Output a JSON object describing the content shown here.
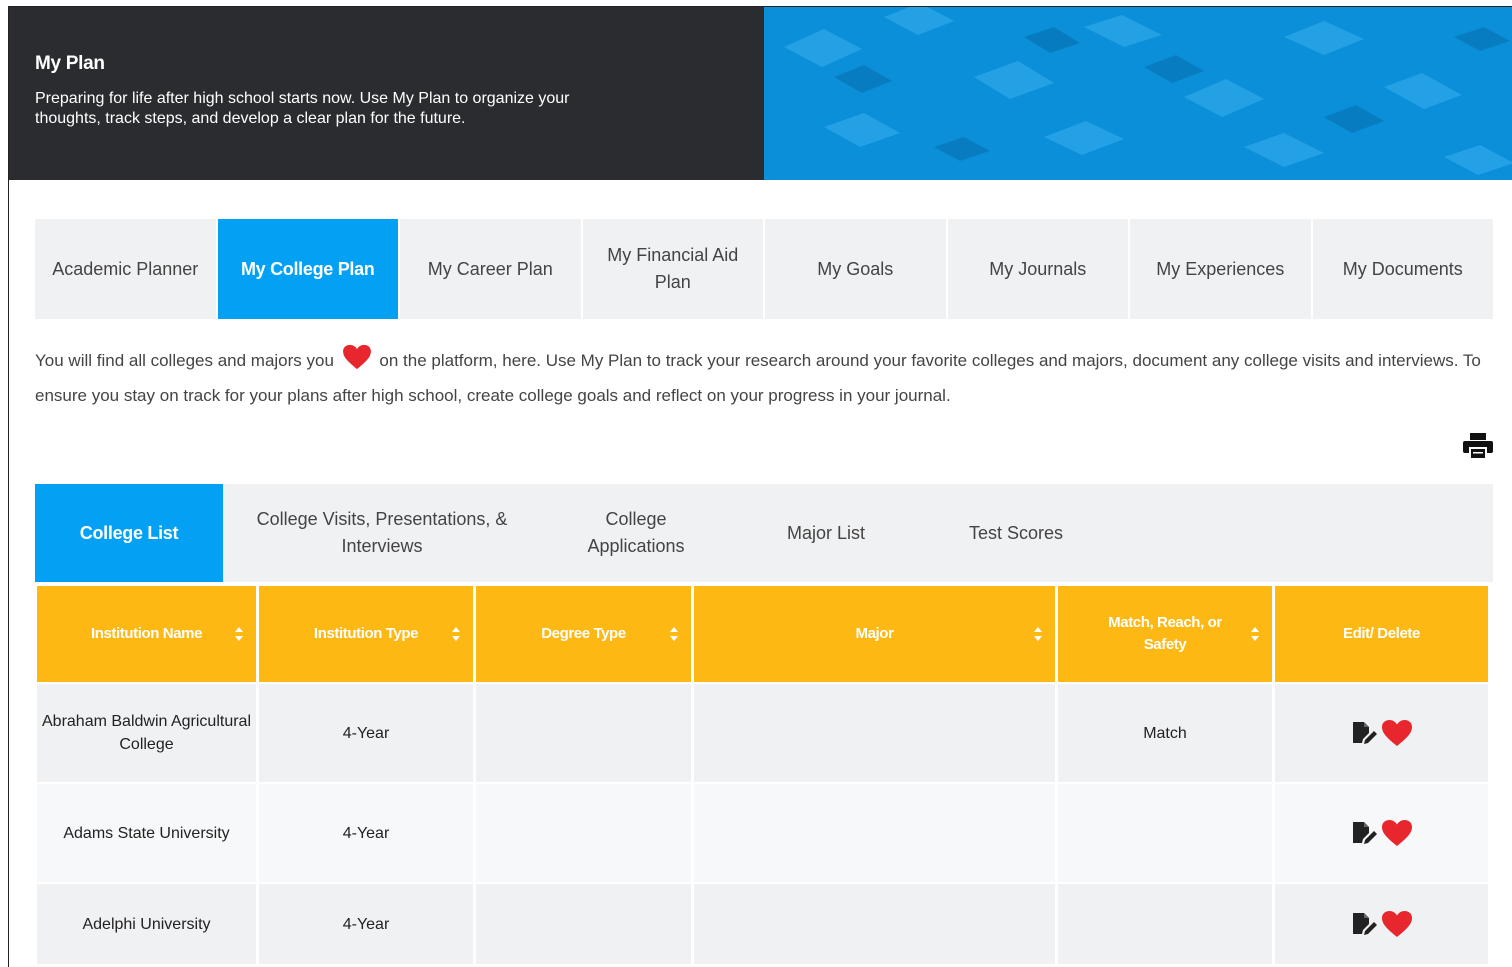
{
  "banner": {
    "title": "My Plan",
    "description": "Preparing for life after high school starts now. Use My Plan to organize your thoughts, track steps, and develop a clear plan for the future."
  },
  "main_tabs": [
    {
      "label": "Academic Planner",
      "active": false
    },
    {
      "label": "My College Plan",
      "active": true
    },
    {
      "label": "My Career Plan",
      "active": false
    },
    {
      "label": "My Financial Aid Plan",
      "active": false
    },
    {
      "label": "My Goals",
      "active": false
    },
    {
      "label": "My Journals",
      "active": false
    },
    {
      "label": "My Experiences",
      "active": false
    },
    {
      "label": "My Documents",
      "active": false
    }
  ],
  "intro": {
    "before_heart": "You will find all colleges and majors you",
    "after_heart": "on the platform, here. Use My Plan to track your research around your favorite colleges and majors, document any college visits and interviews. To ensure you stay on track for your plans after high school, create college goals and reflect on your progress in your journal."
  },
  "sub_tabs": [
    {
      "label": "College List",
      "active": true
    },
    {
      "label": "College Visits, Presentations, & Interviews",
      "active": false
    },
    {
      "label": "College Applications",
      "active": false
    },
    {
      "label": "Major List",
      "active": false
    },
    {
      "label": "Test Scores",
      "active": false
    }
  ],
  "table": {
    "headers": [
      "Institution Name",
      "Institution Type",
      "Degree Type",
      "Major",
      "Match, Reach, or Safety",
      "Edit/ Delete"
    ],
    "rows": [
      {
        "name": "Abraham Baldwin Agricultural College",
        "type": "4-Year",
        "degree": "",
        "major": "",
        "match": "Match"
      },
      {
        "name": "Adams State University",
        "type": "4-Year",
        "degree": "",
        "major": "",
        "match": ""
      },
      {
        "name": "Adelphi University",
        "type": "4-Year",
        "degree": "",
        "major": "",
        "match": ""
      }
    ]
  },
  "colors": {
    "banner_dark": "#2a2c30",
    "banner_blue": "#0a8ed8",
    "active_tab": "#04a0f3",
    "table_header": "#fdb813",
    "heart": "#e8262d"
  },
  "icons": [
    "print-icon",
    "heart-icon",
    "edit-icon",
    "sort-icon"
  ]
}
